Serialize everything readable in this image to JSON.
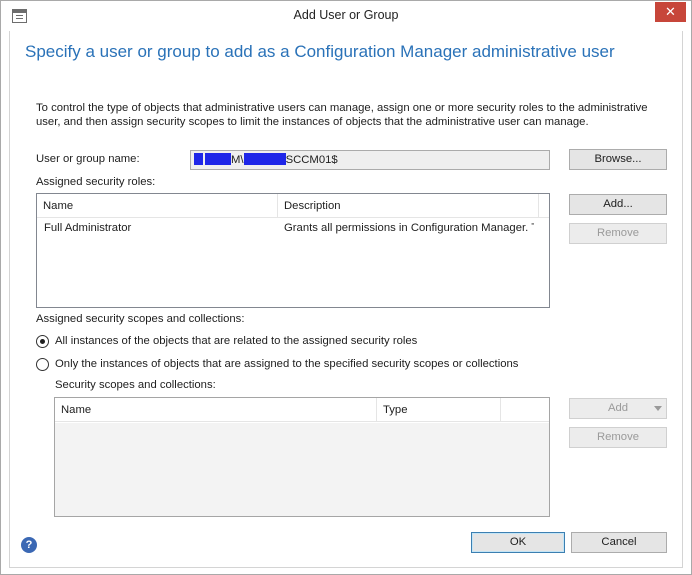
{
  "window": {
    "title": "Add User or Group",
    "close_glyph": "✕"
  },
  "heading": "Specify a user or group to add as a Configuration Manager administrative user",
  "intro": "To control the type of objects that administrative users can manage, assign one or more security roles  to the  administrative user, and then assign security scopes to limit the instances of objects that the administrative user can manage.",
  "user_field": {
    "label": "User or group name:",
    "value_part1": "M\\",
    "value_part2": "SCCM01$"
  },
  "browse_button": "Browse...",
  "roles": {
    "label": "Assigned security roles:",
    "columns": [
      "Name",
      "Description"
    ],
    "rows": [
      {
        "name": "Full Administrator",
        "description": "Grants all permissions in Configuration Manager. T..."
      }
    ],
    "add_button": "Add...",
    "remove_button": "Remove"
  },
  "scopes": {
    "label": "Assigned security scopes and collections:",
    "option_all": "All instances of the objects that are related to the assigned security roles",
    "option_specific": "Only the instances of objects that are assigned to the specified security scopes or collections",
    "selected": "all",
    "list_label": "Security scopes and collections:",
    "columns": [
      "Name",
      "Type"
    ],
    "add_button": "Add",
    "remove_button": "Remove"
  },
  "footer": {
    "ok_button": "OK",
    "cancel_button": "Cancel",
    "help_glyph": "?"
  },
  "colors": {
    "heading": "#2a72b8",
    "close": "#c7463a",
    "redaction": "#1e26e8",
    "help": "#3b68b4"
  },
  "icons": [
    "window-icon",
    "close-icon",
    "help-icon",
    "dropdown-arrow-icon"
  ]
}
